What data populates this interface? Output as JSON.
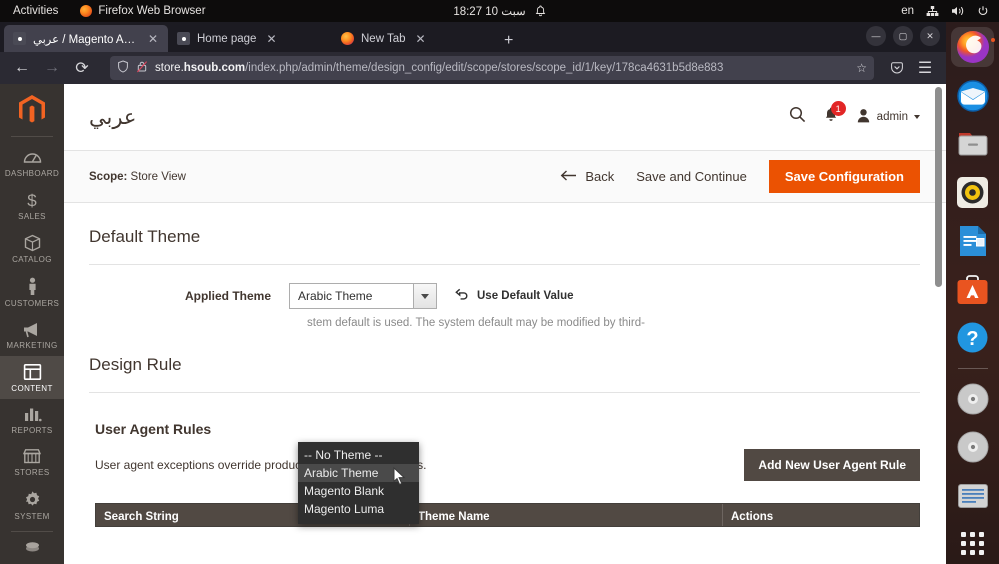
{
  "desktop": {
    "activities": "Activities",
    "app_name": "Firefox Web Browser",
    "clock": "18:27  10 سبت",
    "keyboard_layout": "en",
    "icons": [
      "bell-icon",
      "network-icon",
      "volume-icon",
      "power-icon"
    ]
  },
  "browser": {
    "tabs": [
      {
        "title": "عربي / Magento Admin /",
        "favicon": "page-icon",
        "active": true
      },
      {
        "title": "Home page",
        "favicon": "page-icon",
        "active": false
      },
      {
        "title": "New Tab",
        "favicon": "firefox-icon",
        "active": false
      }
    ],
    "new_tab_label": "+",
    "close_label": "✕",
    "window_controls": {
      "minimize": "—",
      "maximize": "▢",
      "close": "✕"
    },
    "url_prefix": "store.",
    "url_host": "hsoub.com",
    "url_path": "/index.php/admin/theme/design_config/edit/scope/stores/scope_id/1/key/178ca4631b5d8e883",
    "nav": {
      "back": "←",
      "forward": "→",
      "reload": "⟳",
      "bookmark": "☆",
      "pocket": "pocket-icon",
      "menu": "☰"
    }
  },
  "magento": {
    "sidebar": [
      {
        "label": "DASHBOARD",
        "icon": "dashboard-icon",
        "active": false
      },
      {
        "label": "SALES",
        "icon": "sales-icon",
        "active": false
      },
      {
        "label": "CATALOG",
        "icon": "catalog-icon",
        "active": false
      },
      {
        "label": "CUSTOMERS",
        "icon": "customers-icon",
        "active": false
      },
      {
        "label": "MARKETING",
        "icon": "marketing-icon",
        "active": false
      },
      {
        "label": "CONTENT",
        "icon": "content-icon",
        "active": true
      },
      {
        "label": "REPORTS",
        "icon": "reports-icon",
        "active": false
      },
      {
        "label": "STORES",
        "icon": "stores-icon",
        "active": false
      },
      {
        "label": "SYSTEM",
        "icon": "system-icon",
        "active": false
      }
    ],
    "header": {
      "page_title": "عربي",
      "search_icon": "search-icon",
      "notifications_icon": "bell-icon",
      "notifications_count": "1",
      "user_name": "admin"
    },
    "actions": {
      "scope_label": "Scope:",
      "scope_value": "Store View",
      "back": "Back",
      "save_and_continue": "Save and Continue",
      "save_configuration": "Save Configuration"
    },
    "default_theme": {
      "section_title": "Default Theme",
      "field_label": "Applied Theme",
      "selected_value": "Arabic Theme",
      "use_default_label": "Use Default Value",
      "hint": "stem default is used. The system default may be modified by third-",
      "options": [
        {
          "label": "-- No Theme --",
          "selected": false
        },
        {
          "label": "Arabic Theme",
          "selected": true
        },
        {
          "label": "Magento Blank",
          "selected": false
        },
        {
          "label": "Magento Luma",
          "selected": false
        }
      ]
    },
    "design_rule": {
      "section_title": "Design Rule",
      "ua_title": "User Agent Rules",
      "ua_description": "User agent exceptions override product and CMS pages rules.",
      "add_button": "Add New User Agent Rule",
      "table_headers": [
        "Search String",
        "Theme Name",
        "Actions"
      ]
    }
  },
  "dock": {
    "items": [
      {
        "name": "firefox-icon",
        "running": true
      },
      {
        "name": "thunderbird-icon",
        "running": false
      },
      {
        "name": "files-icon",
        "running": false
      },
      {
        "name": "rhythmbox-icon",
        "running": false
      },
      {
        "name": "libreoffice-writer-icon",
        "running": false
      },
      {
        "name": "ubuntu-software-icon",
        "running": false
      },
      {
        "name": "help-icon",
        "running": false
      },
      {
        "name": "disc-icon",
        "running": false
      },
      {
        "name": "disc-2-icon",
        "running": false
      },
      {
        "name": "text-editor-icon",
        "running": false
      }
    ],
    "show_apps": "show-applications-icon"
  },
  "colors": {
    "accent": "#eb5202",
    "magento_nav": "#373330",
    "badge": "#e22626",
    "secondary_button": "#514943"
  }
}
